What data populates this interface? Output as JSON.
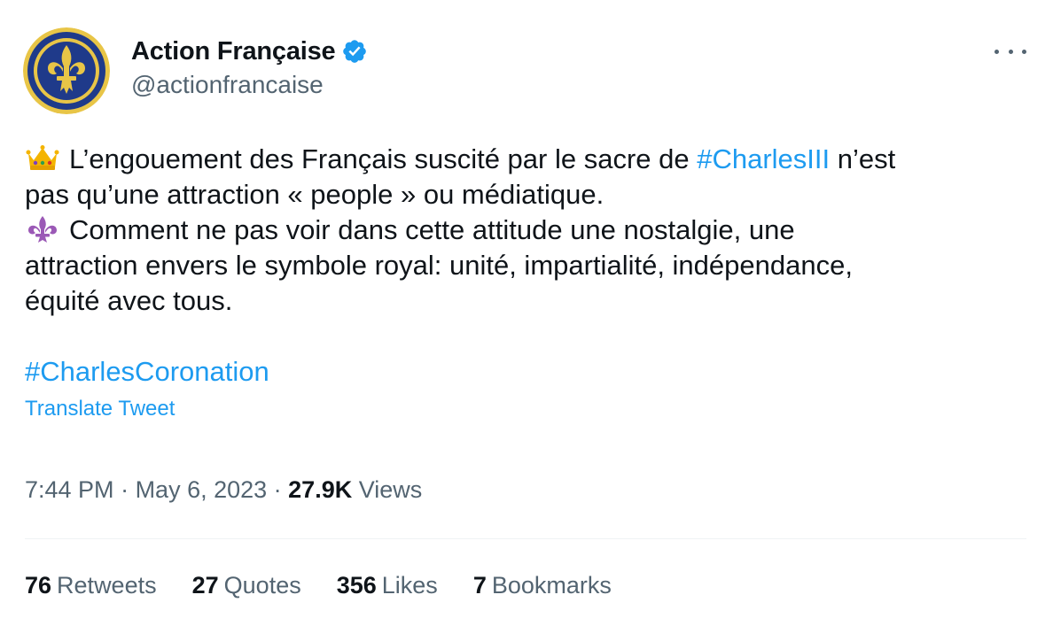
{
  "author": {
    "display_name": "Action Française",
    "handle": "@actionfrancaise",
    "verified_icon": "verified-badge-icon",
    "avatar_icon": "fleur-de-lis-logo"
  },
  "more_icon": "more-options-icon",
  "body": {
    "line1_pre": "L’engouement des Français suscité par le sacre de ",
    "line1_hashtag": "#CharlesIII",
    "line1_post": " n’est",
    "line2": "pas qu’une attraction « people » ou médiatique.",
    "line3": "Comment ne pas voir dans cette attitude une nostalgie, une",
    "line4": "attraction envers le symbole royal: unité, impartialité, indépendance,",
    "line5": "équité avec tous.",
    "emoji1": "crown-emoji",
    "emoji2": "fleur-de-lis-emoji"
  },
  "hashtag2": "#CharlesCoronation",
  "translate_label": "Translate Tweet",
  "meta": {
    "time": "7:44 PM",
    "sep1": " · ",
    "date": "May 6, 2023",
    "sep2": " · ",
    "views_count": "27.9K",
    "views_label": " Views"
  },
  "stats": [
    {
      "count": "76",
      "label": "Retweets"
    },
    {
      "count": "27",
      "label": "Quotes"
    },
    {
      "count": "356",
      "label": "Likes"
    },
    {
      "count": "7",
      "label": "Bookmarks"
    }
  ],
  "colors": {
    "link": "#1d9bf0",
    "text": "#0f1419",
    "secondary": "#536471",
    "avatar_blue": "#1f3a8a",
    "avatar_gold": "#e8c547"
  }
}
